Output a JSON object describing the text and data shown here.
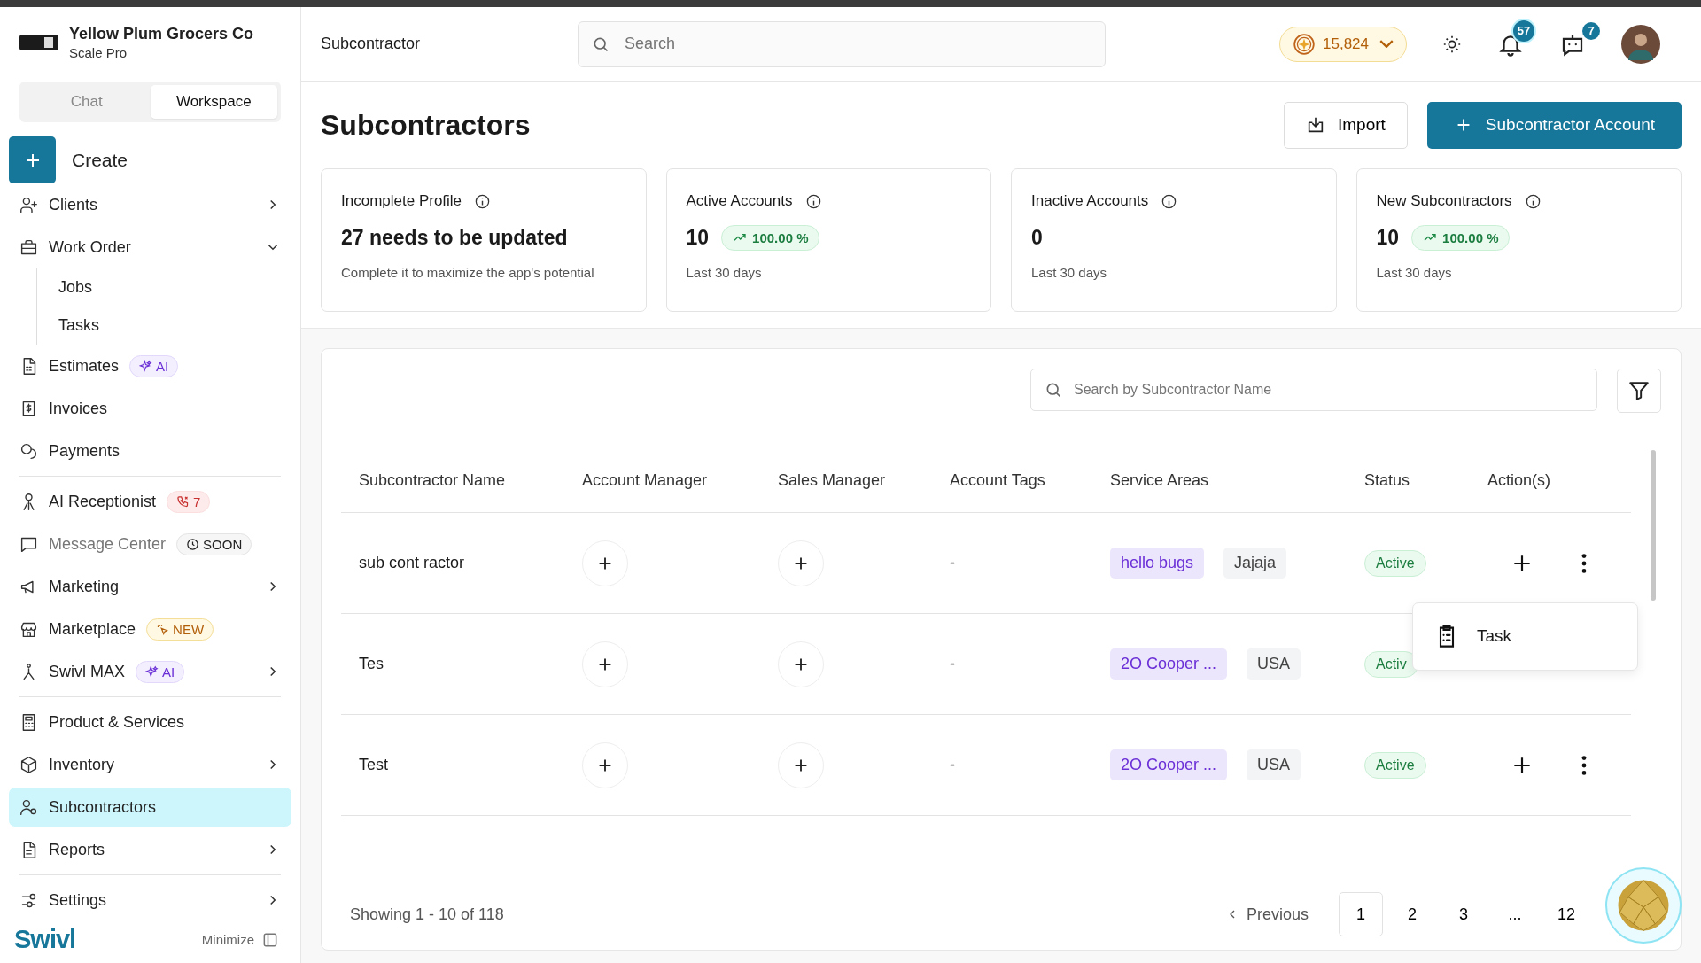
{
  "company": {
    "name": "Yellow Plum Grocers Co",
    "plan": "Scale Pro"
  },
  "mode_tabs": [
    {
      "label": "Chat",
      "selected": false
    },
    {
      "label": "Workspace",
      "selected": true
    }
  ],
  "create_button": {
    "label": "Create"
  },
  "nav_groups": [
    [
      {
        "label": "Clients",
        "expanded": false,
        "selected": false
      },
      {
        "label": "Work Order",
        "expanded": true,
        "selected": false,
        "children": [
          {
            "label": "Jobs"
          },
          {
            "label": "Tasks"
          }
        ]
      },
      {
        "label": "Estimates",
        "selected": false,
        "badge": {
          "kind": "ai",
          "text": "AI"
        }
      },
      {
        "label": "Invoices",
        "selected": false
      },
      {
        "label": "Payments",
        "selected": false
      }
    ],
    [
      {
        "label": "AI Receptionist",
        "selected": false,
        "badge": {
          "kind": "calls",
          "text": "7"
        }
      },
      {
        "label": "Message Center",
        "selected": false,
        "disabled": true,
        "badge": {
          "kind": "soon",
          "text": "SOON"
        }
      },
      {
        "label": "Marketing",
        "expanded": false,
        "selected": false
      },
      {
        "label": "Marketplace",
        "selected": false,
        "badge": {
          "kind": "new",
          "text": "NEW"
        }
      },
      {
        "label": "Swivl MAX",
        "expanded": false,
        "selected": false,
        "badge": {
          "kind": "ai",
          "text": "AI"
        }
      }
    ],
    [
      {
        "label": "Product & Services",
        "selected": false
      },
      {
        "label": "Inventory",
        "expanded": false,
        "selected": false
      },
      {
        "label": "Subcontractors",
        "selected": true
      },
      {
        "label": "Reports",
        "expanded": false,
        "selected": false
      }
    ],
    [
      {
        "label": "Settings",
        "expanded": false,
        "selected": false
      }
    ]
  ],
  "brand": "Swivl",
  "minimize": "Minimize",
  "header": {
    "breadcrumb": "Subcontractor",
    "search_placeholder": "Search",
    "coins": "15,824",
    "notifications": "57",
    "messages": "7"
  },
  "page_title": "Subcontractors",
  "actions": [
    {
      "kind": "secondary",
      "label": "Import"
    },
    {
      "kind": "primary",
      "label": "Subcontractor Account"
    }
  ],
  "stats": [
    {
      "title": "Incomplete Profile",
      "value": "27 needs to be updated",
      "note": "Complete it to maximize the app's potential"
    },
    {
      "title": "Active Accounts",
      "value": "10",
      "change": "100.00 %",
      "note": "Last 30 days"
    },
    {
      "title": "Inactive Accounts",
      "value": "0",
      "note": "Last 30 days"
    },
    {
      "title": "New Subcontractors",
      "value": "10",
      "change": "100.00 %",
      "note": "Last 30 days"
    }
  ],
  "table": {
    "search_placeholder": "Search by Subcontractor Name",
    "columns": [
      "Subcontractor Name",
      "Account Manager",
      "Sales Manager",
      "Account Tags",
      "Service Areas",
      "Status",
      "Action(s)"
    ],
    "rows": [
      {
        "name": "sub cont ractor",
        "tags": "-",
        "areas": [
          {
            "kind": "tag",
            "text": "hello bugs"
          },
          {
            "kind": "plain",
            "text": "Jajaja"
          }
        ],
        "status": "Active",
        "actions_visible": true,
        "menu_open": true
      },
      {
        "name": "Tes",
        "tags": "-",
        "areas": [
          {
            "kind": "tag",
            "text": "2O Cooper ..."
          },
          {
            "kind": "plain",
            "text": "USA"
          }
        ],
        "status": "Activ",
        "actions_visible": false,
        "menu_open": false
      },
      {
        "name": "Test",
        "tags": "-",
        "areas": [
          {
            "kind": "tag",
            "text": "2O Cooper ..."
          },
          {
            "kind": "plain",
            "text": "USA"
          }
        ],
        "status": "Active",
        "actions_visible": true,
        "menu_open": false
      }
    ],
    "menu": [
      {
        "label": "Task"
      }
    ],
    "summary": "Showing 1 - 10 of 118",
    "previous": "Previous",
    "pages": [
      {
        "label": "1",
        "selected": true
      },
      {
        "label": "2",
        "selected": false
      },
      {
        "label": "3",
        "selected": false
      },
      {
        "label": "...",
        "selected": false
      },
      {
        "label": "12",
        "selected": false
      }
    ]
  }
}
